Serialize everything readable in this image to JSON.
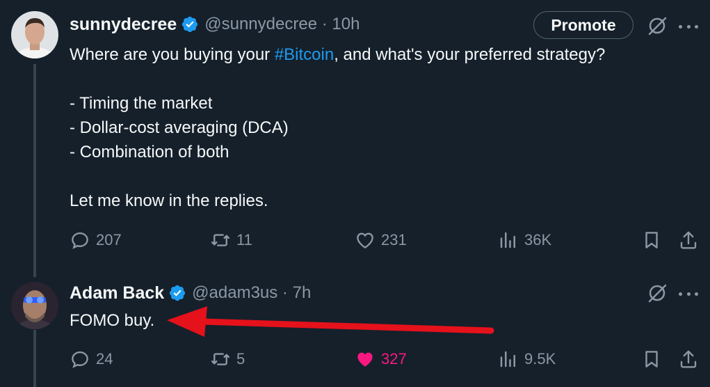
{
  "tweet1": {
    "name": "sunnydecree",
    "handle_time": "@sunnydecree · 10h",
    "promote_label": "Promote",
    "text_before": "Where are you buying your ",
    "hashtag": "#Bitcoin",
    "text_after": ", and what's your preferred strategy?\n\n- Timing the market\n- Dollar-cost averaging (DCA)\n- Combination of both\n\nLet me know in the replies.",
    "replies": "207",
    "retweets": "11",
    "likes": "231",
    "views": "36K"
  },
  "tweet2": {
    "name": "Adam Back",
    "handle_time": "@adam3us · 7h",
    "text": "FOMO buy.",
    "replies": "24",
    "retweets": "5",
    "likes": "327",
    "views": "9.5K",
    "liked": true
  },
  "colors": {
    "background": "#15202b",
    "accent": "#1d9bf0",
    "like": "#f91880",
    "annotation_arrow": "#e5111b"
  },
  "icons": [
    "verified-badge-icon",
    "grok-icon",
    "more-icon",
    "reply-icon",
    "retweet-icon",
    "like-icon",
    "views-icon",
    "bookmark-icon",
    "share-icon"
  ]
}
